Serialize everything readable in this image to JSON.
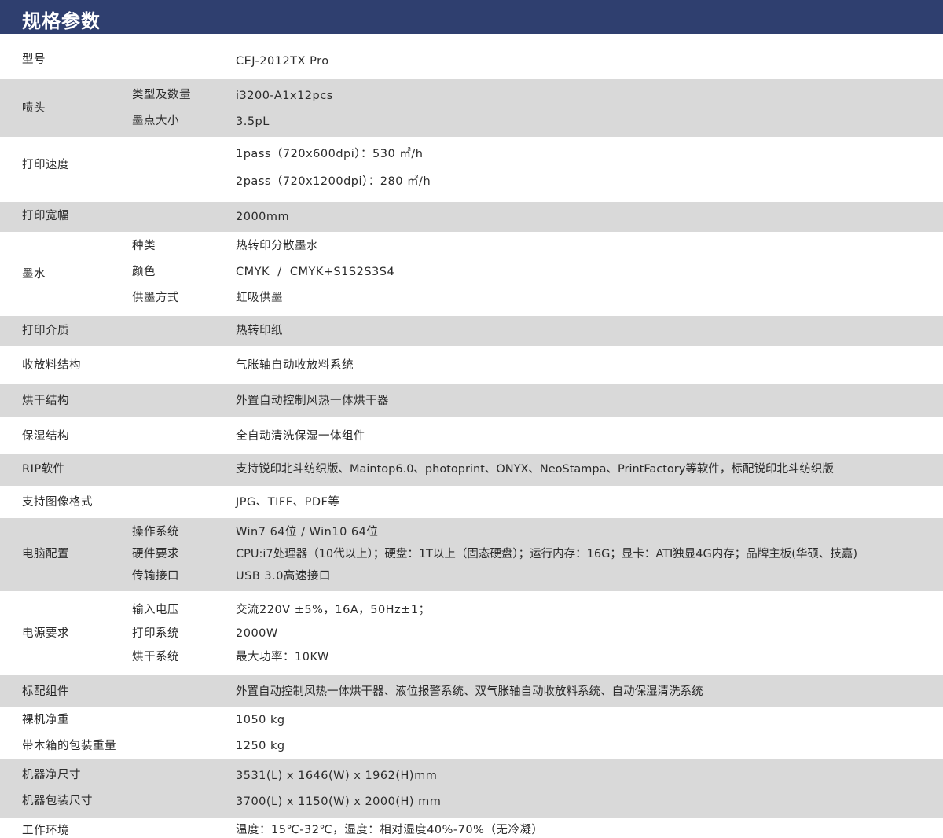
{
  "header": {
    "title": "规格参数"
  },
  "specs": {
    "model": {
      "label": "型号",
      "value": "CEJ-2012TX Pro"
    },
    "printhead": {
      "label": "喷头",
      "type_label": "类型及数量",
      "type_value": "i3200-A1x12pcs",
      "dot_label": "墨点大小",
      "dot_value": "3.5pL"
    },
    "speed": {
      "label": "打印速度",
      "line1": "1pass（720x600dpi）：530 ㎡/h",
      "line2": "2pass（720x1200dpi）：280 ㎡/h"
    },
    "width": {
      "label": "打印宽幅",
      "value": "2000mm"
    },
    "ink": {
      "label": "墨水",
      "kind_label": "种类",
      "kind_value": "热转印分散墨水",
      "color_label": "颜色",
      "color_value": "CMYK  /  CMYK+S1S2S3S4",
      "supply_label": "供墨方式",
      "supply_value": "虹吸供墨"
    },
    "media": {
      "label": "打印介质",
      "value": "热转印纸"
    },
    "winding": {
      "label": "收放料结构",
      "value": "气胀轴自动收放料系统"
    },
    "drying": {
      "label": "烘干结构",
      "value": "外置自动控制风热一体烘干器"
    },
    "moisture": {
      "label": "保湿结构",
      "value": "全自动清洗保湿一体组件"
    },
    "rip": {
      "label": "RIP软件",
      "value": "支持锐印北斗纺织版、Maintop6.0、photoprint、ONYX、NeoStampa、PrintFactory等软件，标配锐印北斗纺织版"
    },
    "image_format": {
      "label": "支持图像格式",
      "value": "JPG、TIFF、PDF等"
    },
    "computer": {
      "label": "电脑配置",
      "os_label": "操作系统",
      "os_value": "Win7 64位 / Win10 64位",
      "hw_label": "硬件要求",
      "hw_value": "CPU:i7处理器（10代以上）；硬盘：1T以上（固态硬盘）；运行内存：16G；显卡：ATI独显4G内存；品牌主板(华硕、技嘉)",
      "port_label": "传输接口",
      "port_value": "USB 3.0高速接口"
    },
    "power": {
      "label": "电源要求",
      "input_label": "输入电压",
      "input_value": "交流220V ±5%，16A，50Hz±1；",
      "print_label": "打印系统",
      "print_value": "2000W",
      "dry_label": "烘干系统",
      "dry_value": "最大功率：10KW"
    },
    "standard": {
      "label": "标配组件",
      "value": "外置自动控制风热一体烘干器、液位报警系统、双气胀轴自动收放料系统、自动保湿清洗系统"
    },
    "net_weight": {
      "label": "裸机净重",
      "value": "1050 kg"
    },
    "pack_weight": {
      "label": "带木箱的包装重量",
      "value": "1250 kg"
    },
    "net_size": {
      "label": "机器净尺寸",
      "value": "3531(L) x 1646(W) x 1962(H)mm"
    },
    "pack_size": {
      "label": "机器包装尺寸",
      "value": "3700(L) x 1150(W) x 2000(H) mm"
    },
    "environment": {
      "label": "工作环境",
      "value": "温度：15℃-32℃，湿度：相对湿度40%-70%（无冷凝）"
    }
  },
  "colors": {
    "header_bg": "#2f3f6f",
    "band_bg": "#d9d9d9",
    "text": "#2b2b2b"
  }
}
